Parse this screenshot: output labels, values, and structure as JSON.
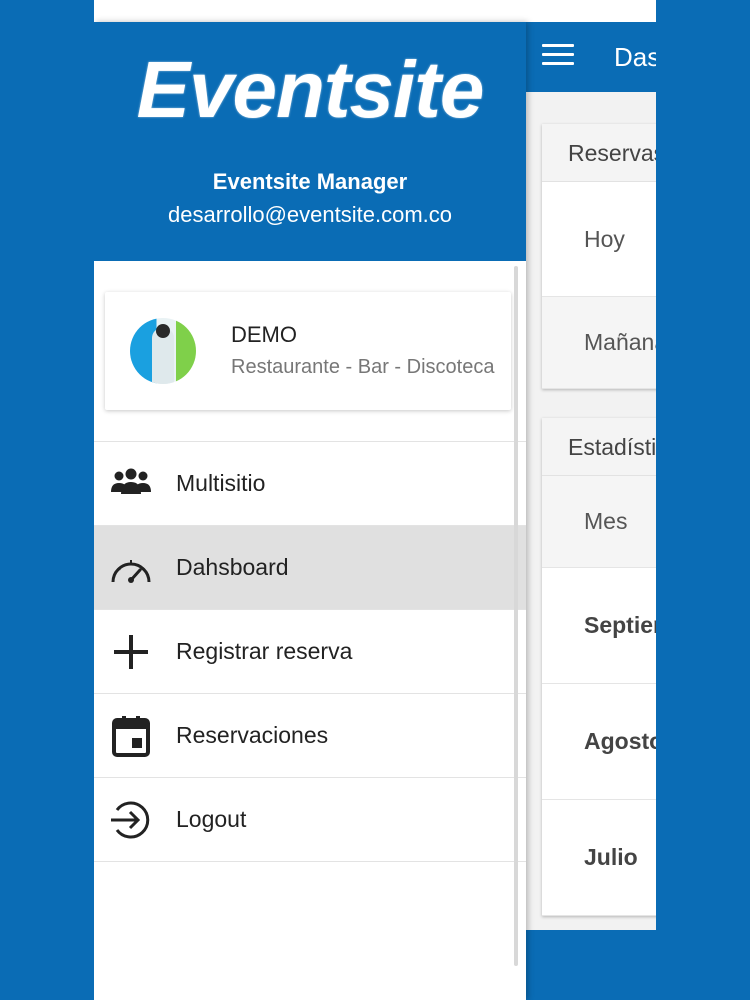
{
  "app": {
    "title": "Dashboard",
    "reservas_card": {
      "header": "Reservas",
      "rows": [
        {
          "label": "Hoy"
        },
        {
          "label": "Mañana"
        }
      ]
    },
    "estadisticas_card": {
      "header": "Estadísticas",
      "rows": [
        {
          "label": "Mes"
        },
        {
          "label": "Septiembre"
        },
        {
          "label": "Agosto"
        },
        {
          "label": "Julio"
        }
      ]
    }
  },
  "drawer": {
    "logo_text": "Eventsite",
    "manager_name": "Eventsite Manager",
    "manager_email": "desarrollo@eventsite.com.co",
    "site": {
      "name": "DEMO",
      "description": "Restaurante - Bar - Discoteca"
    },
    "menu": [
      {
        "label": "Multisitio",
        "icon": "group-icon"
      },
      {
        "label": "Dahsboard",
        "icon": "speedometer-icon",
        "active": true
      },
      {
        "label": "Registrar reserva",
        "icon": "plus-icon"
      },
      {
        "label": "Reservaciones",
        "icon": "calendar-icon"
      },
      {
        "label": "Logout",
        "icon": "logout-icon"
      }
    ]
  },
  "colors": {
    "brand": "#0a6cb5",
    "active_item": "#e0e0e0"
  }
}
